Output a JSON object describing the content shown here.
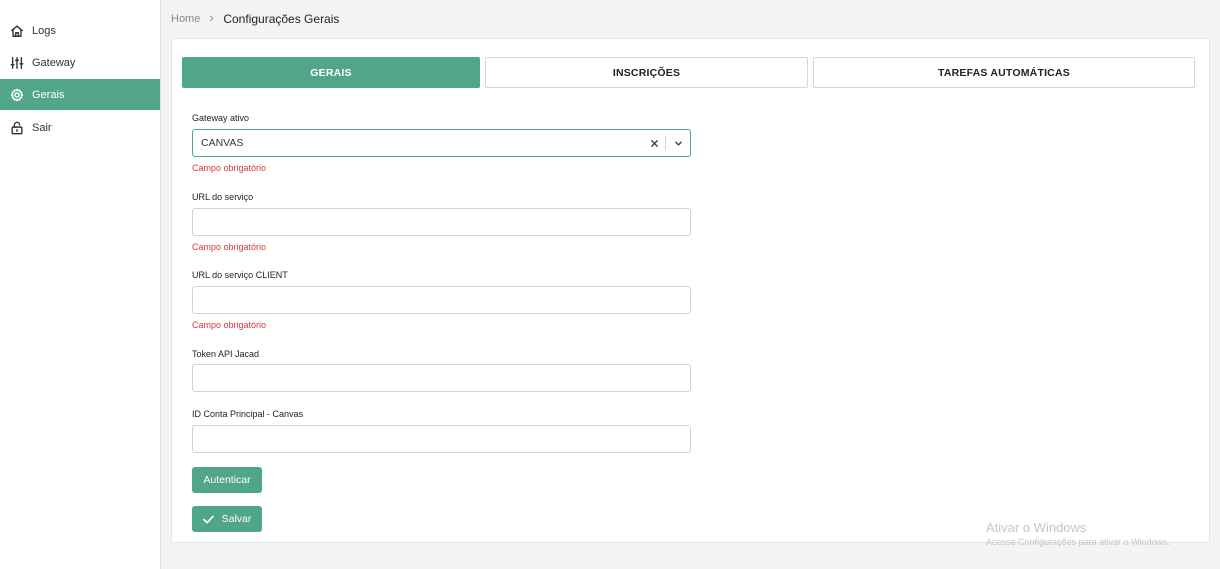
{
  "sidebar": {
    "items": [
      {
        "label": "Logs",
        "icon": "home-icon"
      },
      {
        "label": "Gateway",
        "icon": "sliders-icon"
      },
      {
        "label": "Gerais",
        "icon": "gear-icon",
        "active": true
      },
      {
        "label": "Sair",
        "icon": "unlock-icon"
      }
    ]
  },
  "breadcrumb": {
    "home": "Home",
    "current": "Configurações Gerais"
  },
  "tabs": [
    {
      "label": "GERAIS",
      "active": true
    },
    {
      "label": "INSCRIÇÕES"
    },
    {
      "label": "TAREFAS AUTOMÁTICAS"
    }
  ],
  "form": {
    "gateway": {
      "label": "Gateway ativo",
      "value": "CANVAS",
      "error": "Campo obrigatório"
    },
    "service_url": {
      "label": "URL do serviço",
      "value": "",
      "error": "Campo obrigatório"
    },
    "client_url": {
      "label": "URL do serviço CLIENT",
      "value": "",
      "error": "Campo obrigatório"
    },
    "token": {
      "label": "Token API Jacad",
      "value": ""
    },
    "account_id": {
      "label": "ID Conta Principal - Canvas",
      "value": ""
    }
  },
  "buttons": {
    "authenticate": "Autenticar",
    "save": "Salvar"
  },
  "watermark": {
    "title": "Ativar o Windows",
    "subtitle": "Acesse Configurações para ativar o Windows."
  },
  "colors": {
    "accent": "#51a58a",
    "error": "#d9363e"
  }
}
